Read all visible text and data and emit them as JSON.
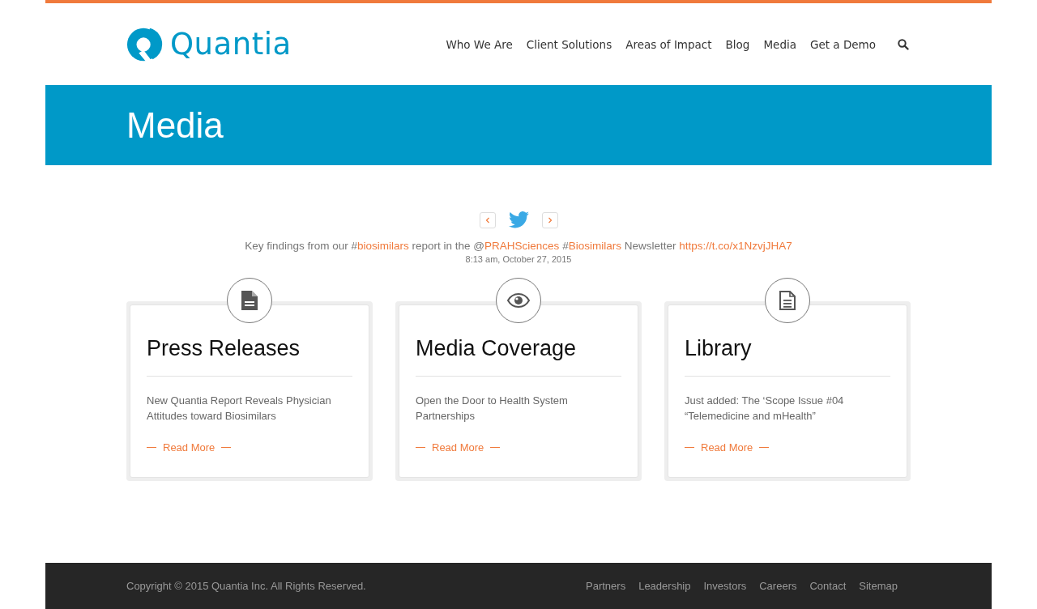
{
  "brand": {
    "name": "Quantia"
  },
  "nav": [
    {
      "label": "Who We Are"
    },
    {
      "label": "Client Solutions"
    },
    {
      "label": "Areas of Impact"
    },
    {
      "label": "Blog"
    },
    {
      "label": "Media"
    },
    {
      "label": "Get a Demo"
    }
  ],
  "page_title": "Media",
  "tweet": {
    "segments": [
      {
        "kind": "text",
        "text": "Key findings from our #"
      },
      {
        "kind": "link",
        "text": "biosimilars"
      },
      {
        "kind": "text",
        "text": " report in the @"
      },
      {
        "kind": "link",
        "text": "PRAHSciences"
      },
      {
        "kind": "text",
        "text": " #"
      },
      {
        "kind": "link",
        "text": "Biosimilars"
      },
      {
        "kind": "text",
        "text": " Newsletter "
      },
      {
        "kind": "link",
        "text": "https://t.co/x1NzvjJHA7"
      }
    ],
    "time": "8:13 am, October 27, 2015"
  },
  "cards": [
    {
      "kind": "file-solid",
      "title": "Press Releases",
      "text": "New Quantia Report Reveals Physician Attitudes toward Biosimilars",
      "link": "Read More"
    },
    {
      "kind": "eye",
      "title": "Media Coverage",
      "text": "Open the Door to Health System Partnerships",
      "link": "Read More"
    },
    {
      "kind": "file-outline",
      "title": "Library",
      "text": "Just added: The ‘Scope Issue #04 “Telemedicine and mHealth”",
      "link": "Read More"
    }
  ],
  "footer": {
    "copyright": "Copyright © 2015 Quantia Inc. All Rights Reserved.",
    "links": [
      "Partners",
      "Leadership",
      "Investors",
      "Careers",
      "Contact",
      "Sitemap"
    ]
  }
}
